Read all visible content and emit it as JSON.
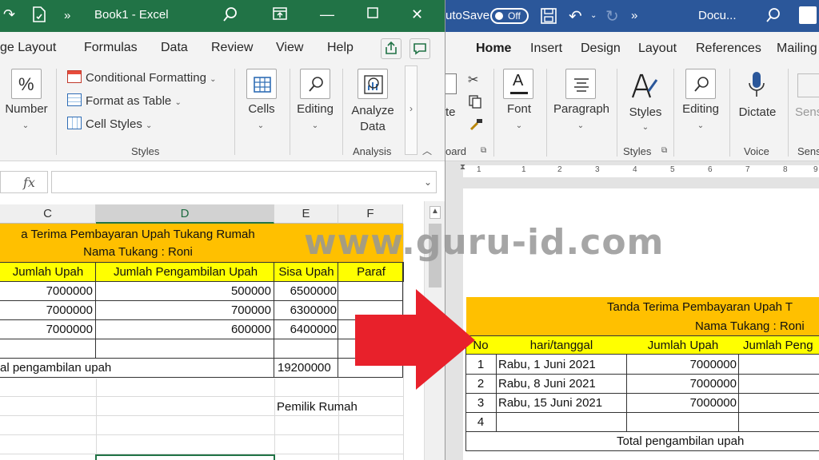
{
  "excel": {
    "title": "Book1  -  Excel",
    "tabs": [
      "ge Layout",
      "Formulas",
      "Data",
      "Review",
      "View",
      "Help"
    ],
    "ribbon": {
      "number_label": "Number",
      "conditional_formatting": "Conditional Formatting",
      "format_as_table": "Format as Table",
      "cell_styles": "Cell Styles",
      "styles_group": "Styles",
      "cells_label": "Cells",
      "editing_label": "Editing",
      "analyze_label_1": "Analyze",
      "analyze_label_2": "Data",
      "analysis_group": "Analysis"
    },
    "formula_bar": {
      "fx": "fx",
      "value": ""
    },
    "columns": [
      "C",
      "D",
      "E",
      "F"
    ],
    "sheet": {
      "title": "a Terima Pembayaran Upah Tukang Rumah",
      "subtitle": "Nama Tukang : Roni",
      "headers": [
        "Jumlah Upah",
        "Jumlah Pengambilan Upah",
        "Sisa Upah",
        "Paraf"
      ],
      "rows": [
        [
          "7000000",
          "500000",
          "6500000",
          ""
        ],
        [
          "7000000",
          "700000",
          "6300000",
          ""
        ],
        [
          "7000000",
          "600000",
          "6400000",
          ""
        ]
      ],
      "total_label": "al pengambilan upah",
      "total_value": "19200000",
      "owner_label": "Pemilik Rumah"
    }
  },
  "word": {
    "autosave_label": "utoSave",
    "autosave_state": "Off",
    "doc_title": "Docu...",
    "tabs": [
      "Home",
      "Insert",
      "Design",
      "Layout",
      "References",
      "Mailing"
    ],
    "ribbon": {
      "paste_label": "te",
      "clipboard_group": "oard",
      "font_label": "Font",
      "paragraph_label": "Paragraph",
      "styles_label": "Styles",
      "styles_group": "Styles",
      "editing_label": "Editing",
      "dictate_label": "Dictate",
      "voice_group": "Voice",
      "sensitivity_label": "Sens",
      "sensitivity_group": "Sens"
    },
    "ruler_numbers": [
      "1",
      "1",
      "2",
      "3",
      "4",
      "5",
      "6",
      "7",
      "8",
      "9"
    ],
    "doc": {
      "title": "Tanda Terima Pembayaran Upah T",
      "subtitle": "Nama Tukang : Roni",
      "headers": [
        "No",
        "hari/tanggal",
        "Jumlah Upah",
        "Jumlah Peng"
      ],
      "rows": [
        [
          "1",
          "Rabu, 1 Juni 2021",
          "7000000"
        ],
        [
          "2",
          "Rabu, 8 Juni 2021",
          "7000000"
        ],
        [
          "3",
          "Rabu, 15 Juni 2021",
          "7000000"
        ],
        [
          "4",
          "",
          ""
        ]
      ],
      "total_label": "Total pengambilan upah"
    }
  },
  "overlay": {
    "watermark": "www.guru-id.com",
    "arrow_color": "#e8212b"
  },
  "colors": {
    "excel_green": "#217346",
    "word_blue": "#2b579a",
    "title_fill": "#ffc000",
    "header_fill": "#ffff00"
  }
}
